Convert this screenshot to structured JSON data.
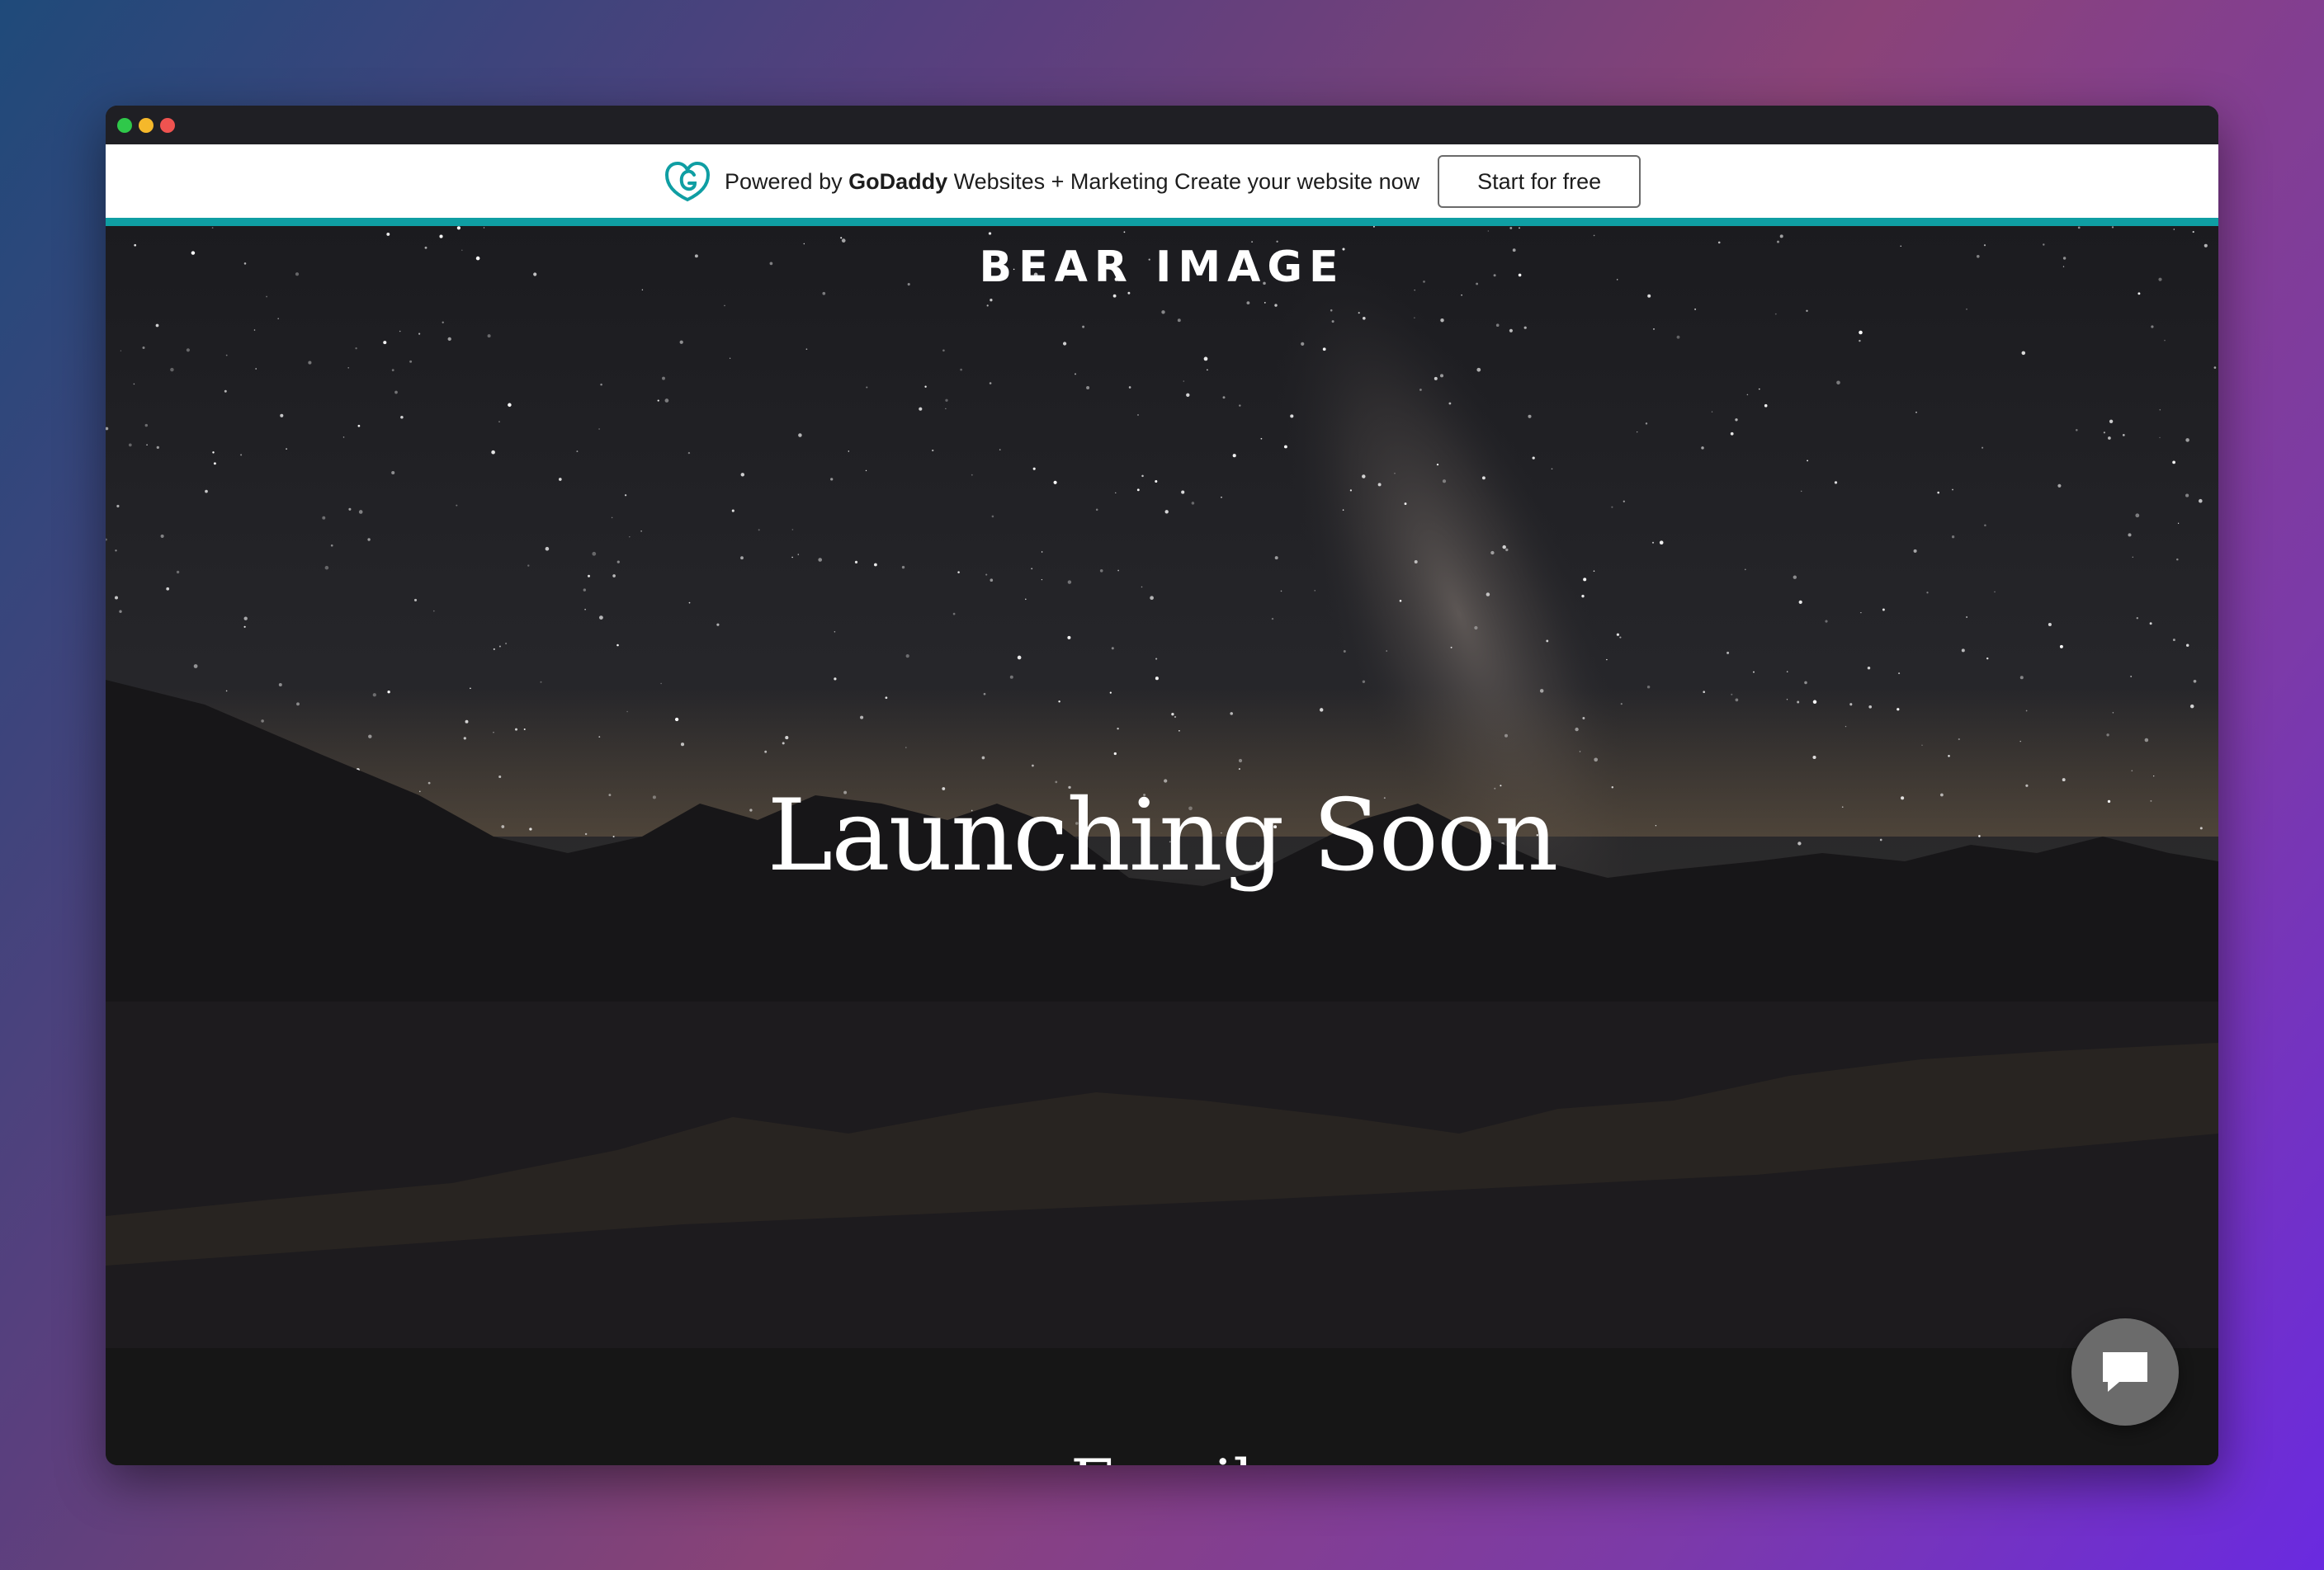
{
  "window": {
    "controls": [
      "green",
      "yellow",
      "red"
    ]
  },
  "promo": {
    "prefix": "Powered by ",
    "brand": "GoDaddy",
    "suffix": " Websites + Marketing Create your website now",
    "button_label": "Start for free",
    "accent": "#0f9ea3",
    "logo_icon": "godaddy-logo-icon"
  },
  "hero": {
    "site_name": "BEAR IMAGE",
    "headline": "Launching Soon",
    "background": "starry-night-mountain-lake"
  },
  "footer": {
    "partial_heading": "Email"
  },
  "chat": {
    "icon": "chat-bubble-icon"
  }
}
